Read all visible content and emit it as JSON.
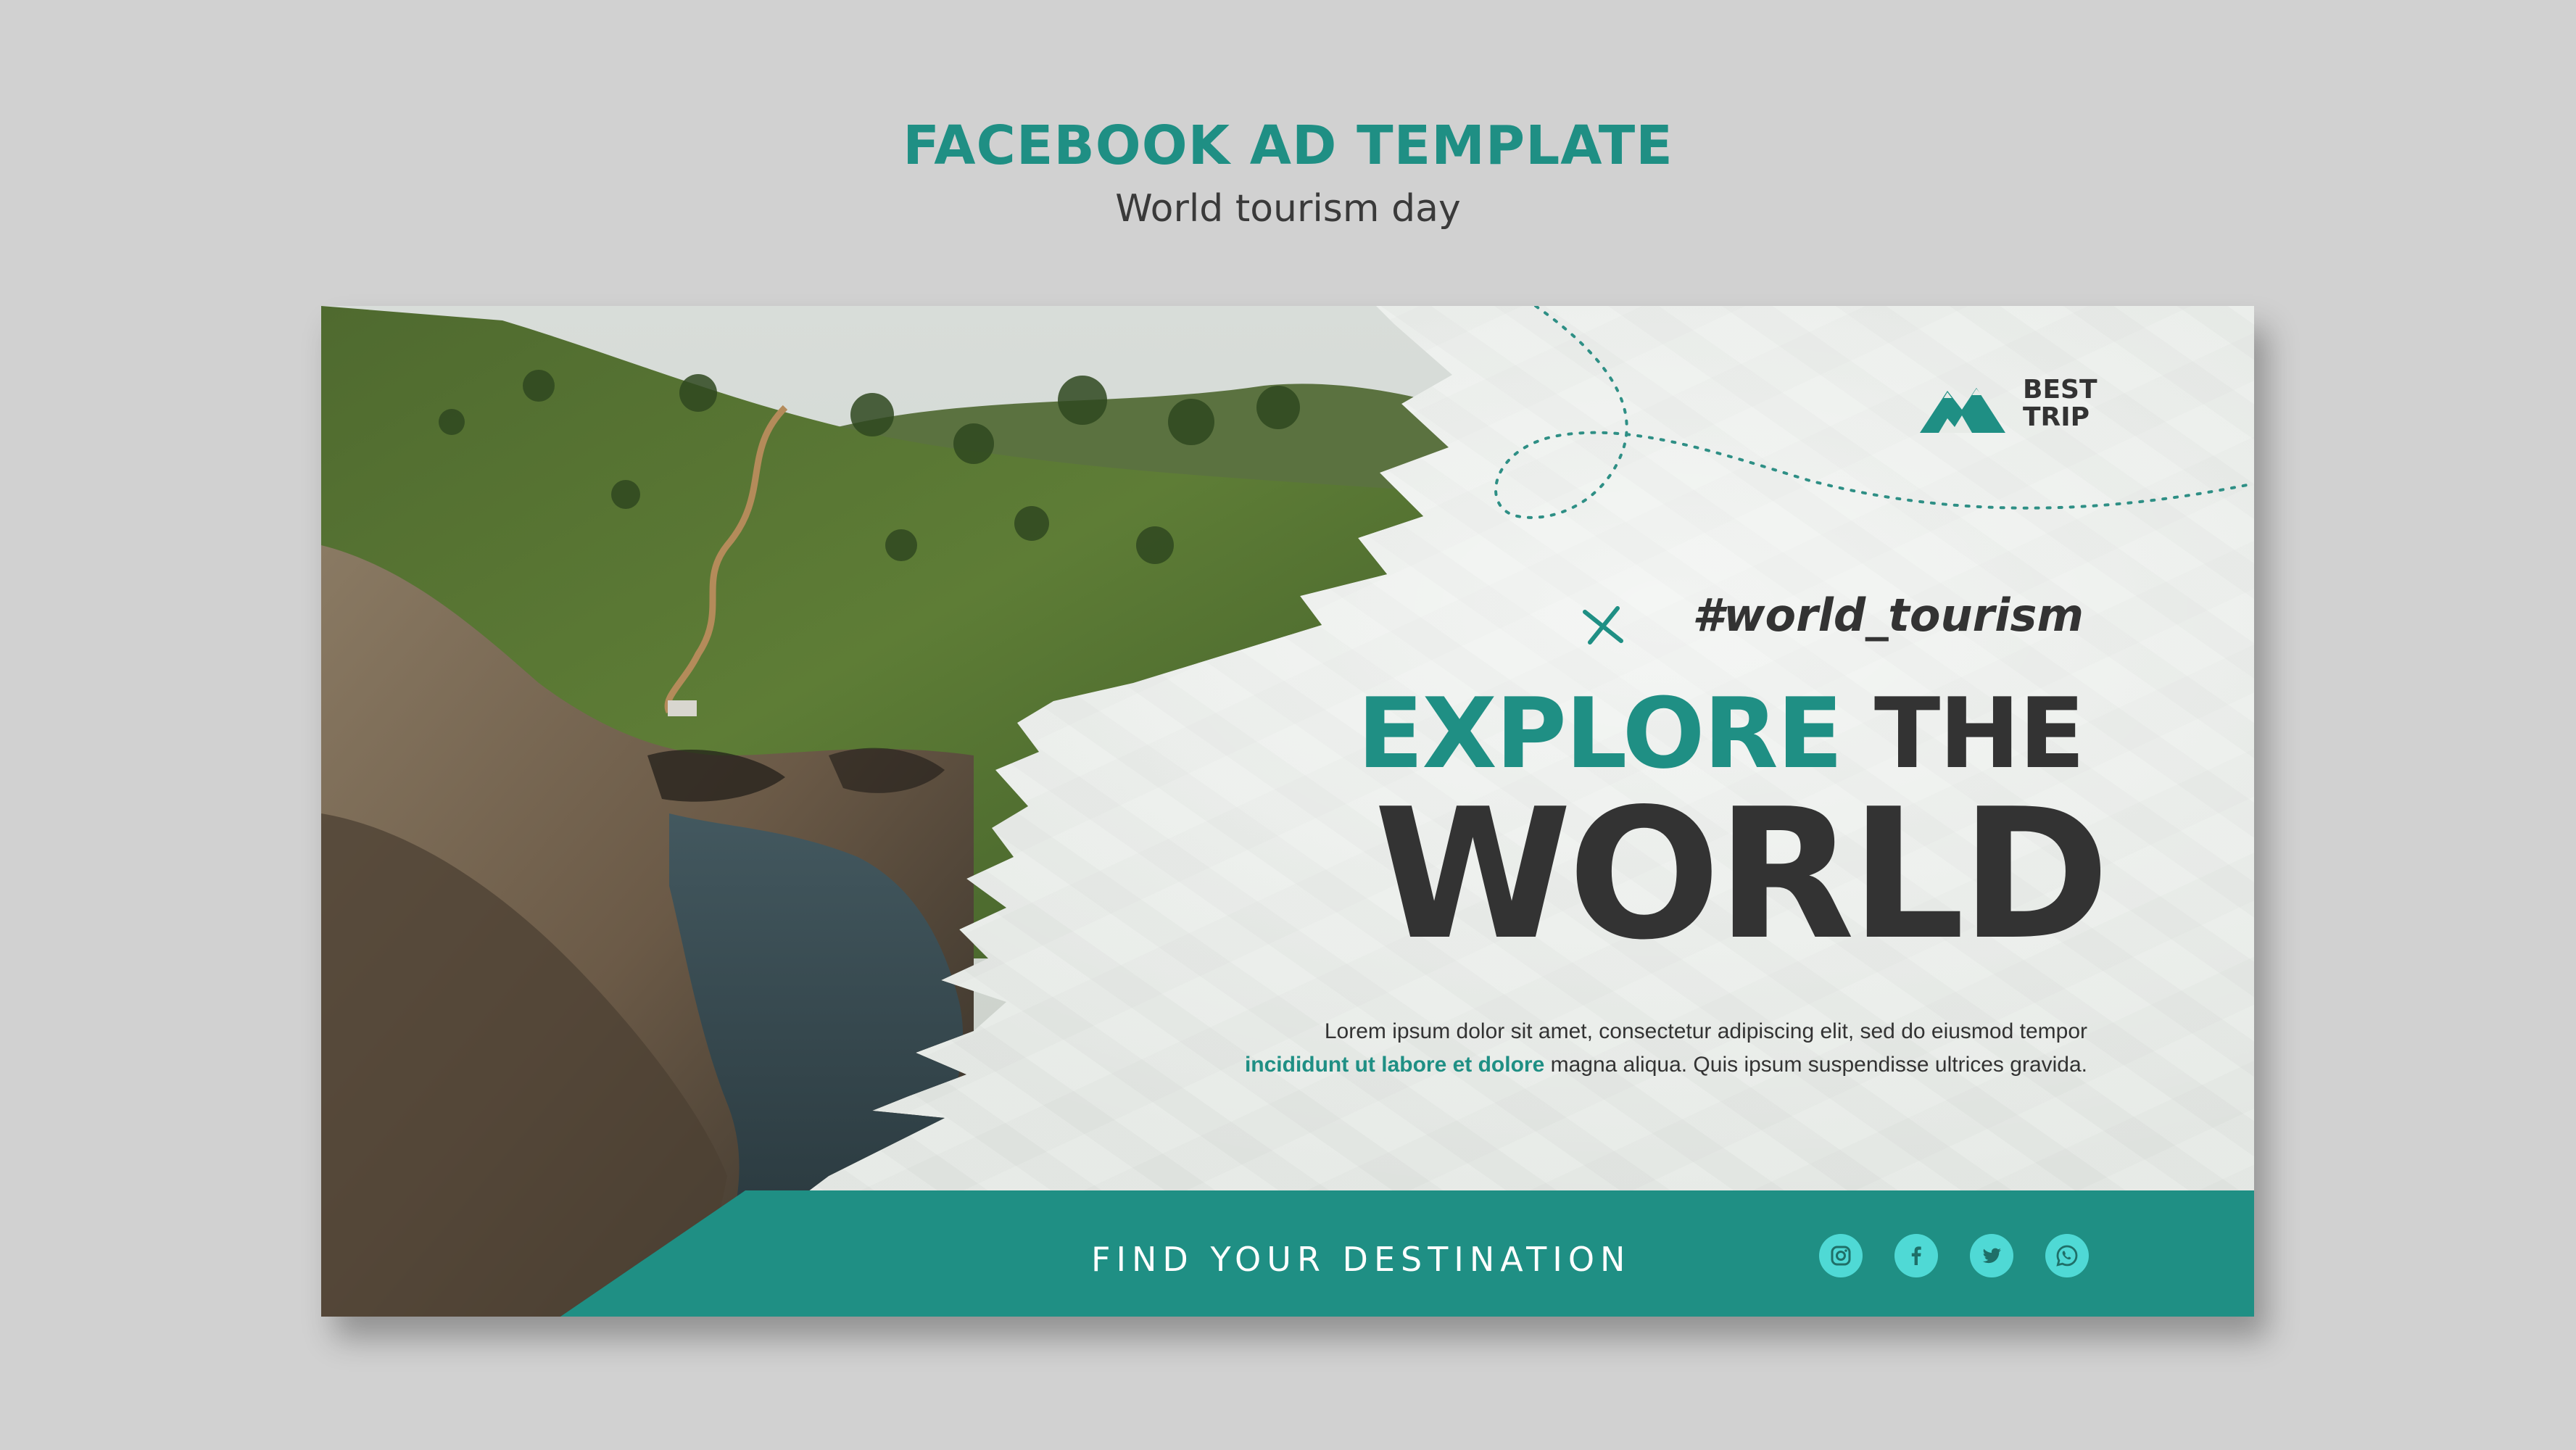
{
  "header": {
    "title": "FACEBOOK AD TEMPLATE",
    "subtitle": "World tourism day"
  },
  "card": {
    "logo": {
      "line1": "BEST",
      "line2": "TRIP"
    },
    "hashtag": "#world_tourism",
    "headline": {
      "word1": "EXPLORE",
      "word2": "THE",
      "word3": "WORLD"
    },
    "body": {
      "line1": "Lorem ipsum dolor sit amet, consectetur adipiscing elit, sed do eiusmod tempor",
      "line2_highlight": "incididunt ut labore et dolore",
      "line2_rest": " magna aliqua. Quis ipsum suspendisse ultrices gravida."
    },
    "footer": {
      "tagline": "FIND YOUR DESTINATION",
      "social_icons": [
        "instagram-icon",
        "facebook-icon",
        "twitter-icon",
        "whatsapp-icon"
      ]
    }
  },
  "colors": {
    "teal": "#1f8f84",
    "dark": "#333333",
    "background": "#d1d1d1",
    "social_circle": "#4fd9d5"
  }
}
